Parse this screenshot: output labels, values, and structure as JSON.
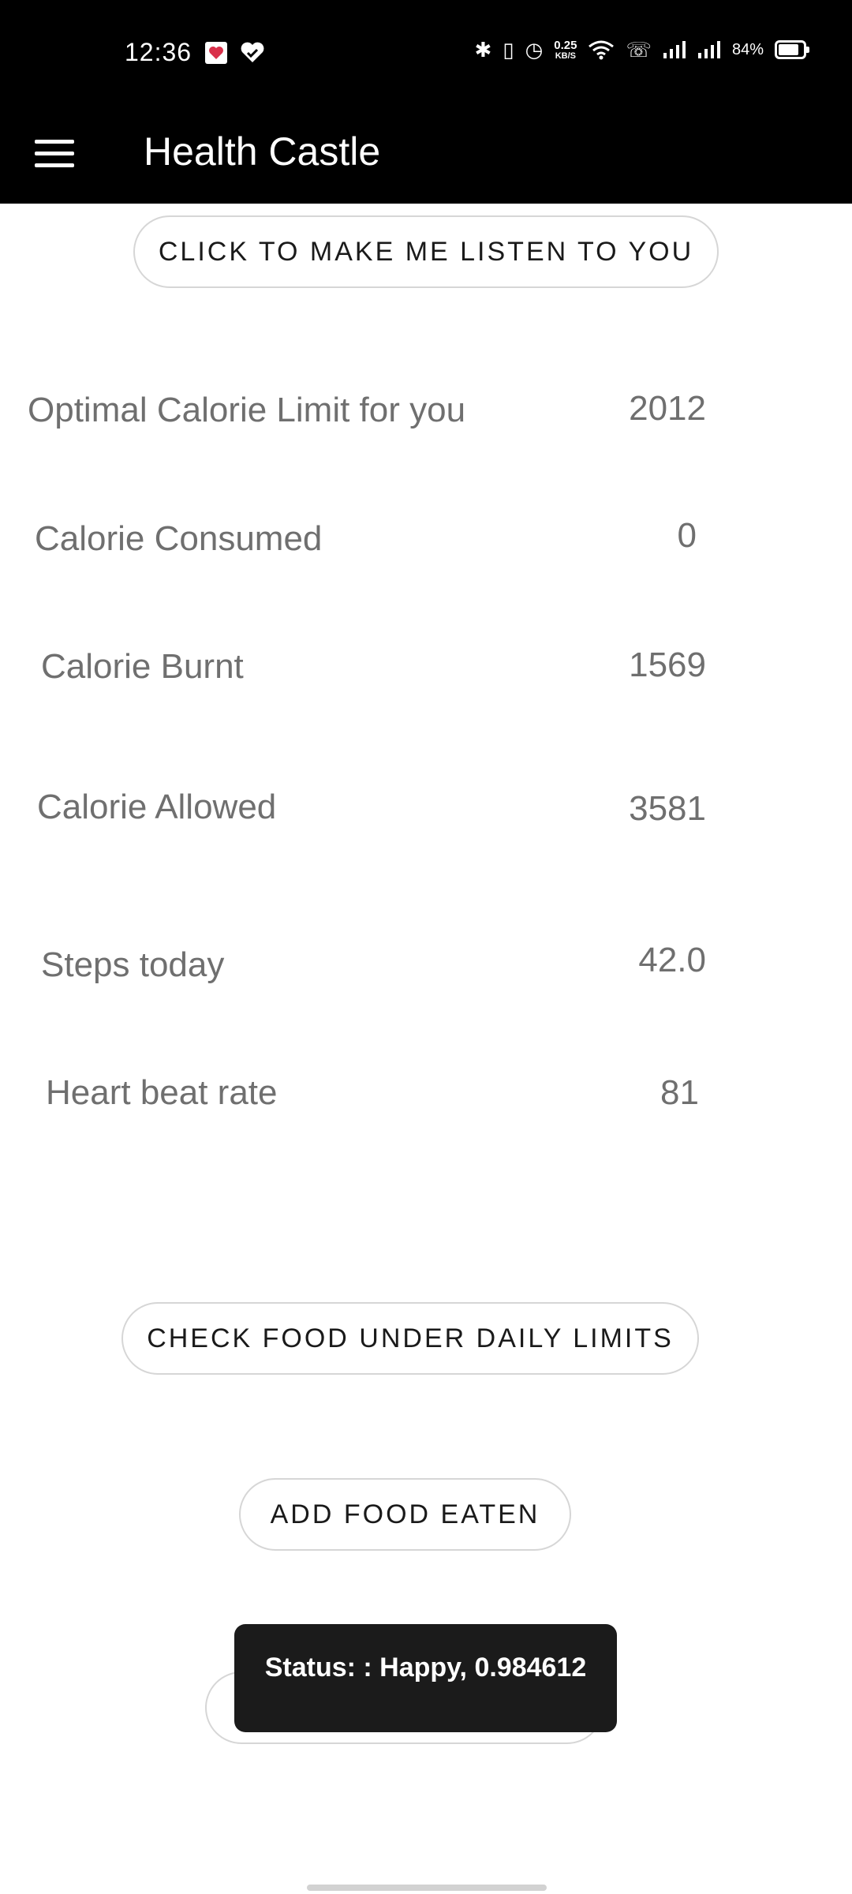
{
  "status_bar": {
    "time": "12:36",
    "net_speed_value": "0.25",
    "net_speed_unit": "KB/S",
    "battery": "84%",
    "battery_level": 0.84,
    "icons": [
      "health-app-icon",
      "heart-check-icon",
      "bluetooth-icon",
      "vibrate-icon",
      "alarm-icon",
      "wifi-icon",
      "wifi-calling-icon",
      "signal-icon",
      "signal-icon",
      "battery-icon"
    ]
  },
  "appbar": {
    "title": "Health Castle",
    "menu_icon": "hamburger-menu-icon"
  },
  "buttons": {
    "listen": "CLICK TO MAKE ME LISTEN TO YOU",
    "check_food": "CHECK FOOD UNDER DAILY LIMITS",
    "add_food": "ADD FOOD EATEN"
  },
  "stats": {
    "optimal_limit": {
      "label": "Optimal Calorie Limit for you",
      "value": "2012"
    },
    "consumed": {
      "label": "Calorie Consumed",
      "value": "0"
    },
    "burnt": {
      "label": "Calorie Burnt",
      "value": "1569"
    },
    "allowed": {
      "label": "Calorie Allowed",
      "value": "3581"
    },
    "steps": {
      "label": "Steps today",
      "value": "42.0"
    },
    "heart_rate": {
      "label": "Heart beat rate",
      "value": "81"
    }
  },
  "toast": {
    "text": "Status: : Happy, 0.984612"
  }
}
